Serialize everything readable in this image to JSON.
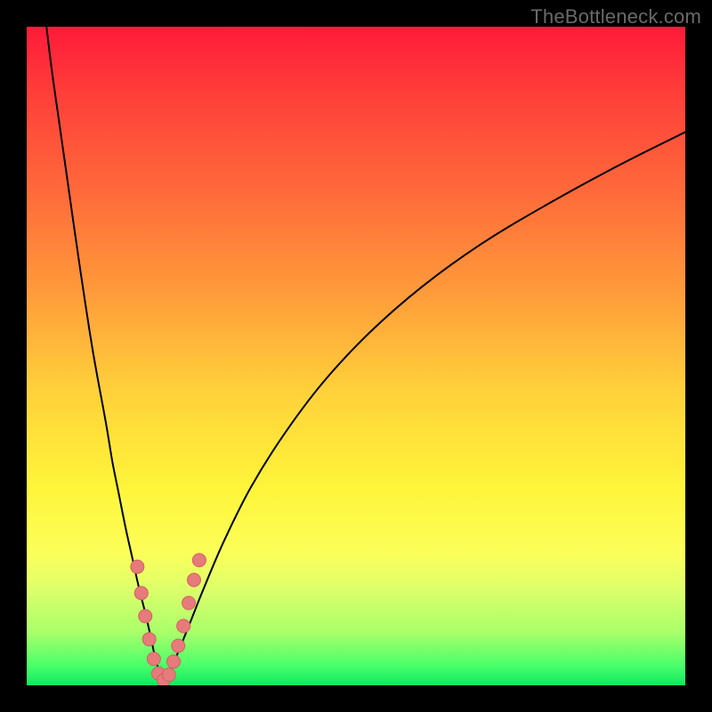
{
  "watermark": "TheBottleneck.com",
  "colors": {
    "frame": "#000000",
    "curve": "#000000",
    "marker_fill": "#e77a7a",
    "marker_stroke": "#d06262"
  },
  "chart_data": {
    "type": "line",
    "title": "",
    "xlabel": "",
    "ylabel": "",
    "xlim": [
      0,
      100
    ],
    "ylim": [
      0,
      100
    ],
    "grid": false,
    "legend": false,
    "series": [
      {
        "name": "left-branch",
        "x": [
          3,
          4,
          6,
          8,
          10,
          12,
          13,
          14,
          15,
          16,
          17,
          18,
          18.8,
          19.4,
          20,
          20.6
        ],
        "y": [
          100,
          92,
          78,
          64,
          51,
          40,
          34,
          29,
          24,
          19.5,
          15,
          11,
          7.5,
          4.7,
          2.4,
          0.6
        ]
      },
      {
        "name": "right-branch",
        "x": [
          21,
          21.6,
          22.4,
          23.4,
          25,
          27,
          30,
          34,
          39,
          45,
          52,
          60,
          69,
          79,
          90,
          100
        ],
        "y": [
          0.4,
          1.6,
          3.6,
          6,
          10,
          15,
          22,
          30,
          38,
          46,
          53.5,
          60.5,
          67,
          73,
          79,
          84
        ]
      }
    ],
    "markers": [
      {
        "x": 16.8,
        "y": 18
      },
      {
        "x": 17.4,
        "y": 14
      },
      {
        "x": 18.0,
        "y": 10.5
      },
      {
        "x": 18.6,
        "y": 7
      },
      {
        "x": 19.3,
        "y": 4
      },
      {
        "x": 20.0,
        "y": 1.8
      },
      {
        "x": 20.8,
        "y": 0.8
      },
      {
        "x": 21.6,
        "y": 1.6
      },
      {
        "x": 22.3,
        "y": 3.6
      },
      {
        "x": 23.0,
        "y": 6
      },
      {
        "x": 23.8,
        "y": 9
      },
      {
        "x": 24.6,
        "y": 12.5
      },
      {
        "x": 25.4,
        "y": 16
      },
      {
        "x": 26.2,
        "y": 19
      }
    ]
  }
}
